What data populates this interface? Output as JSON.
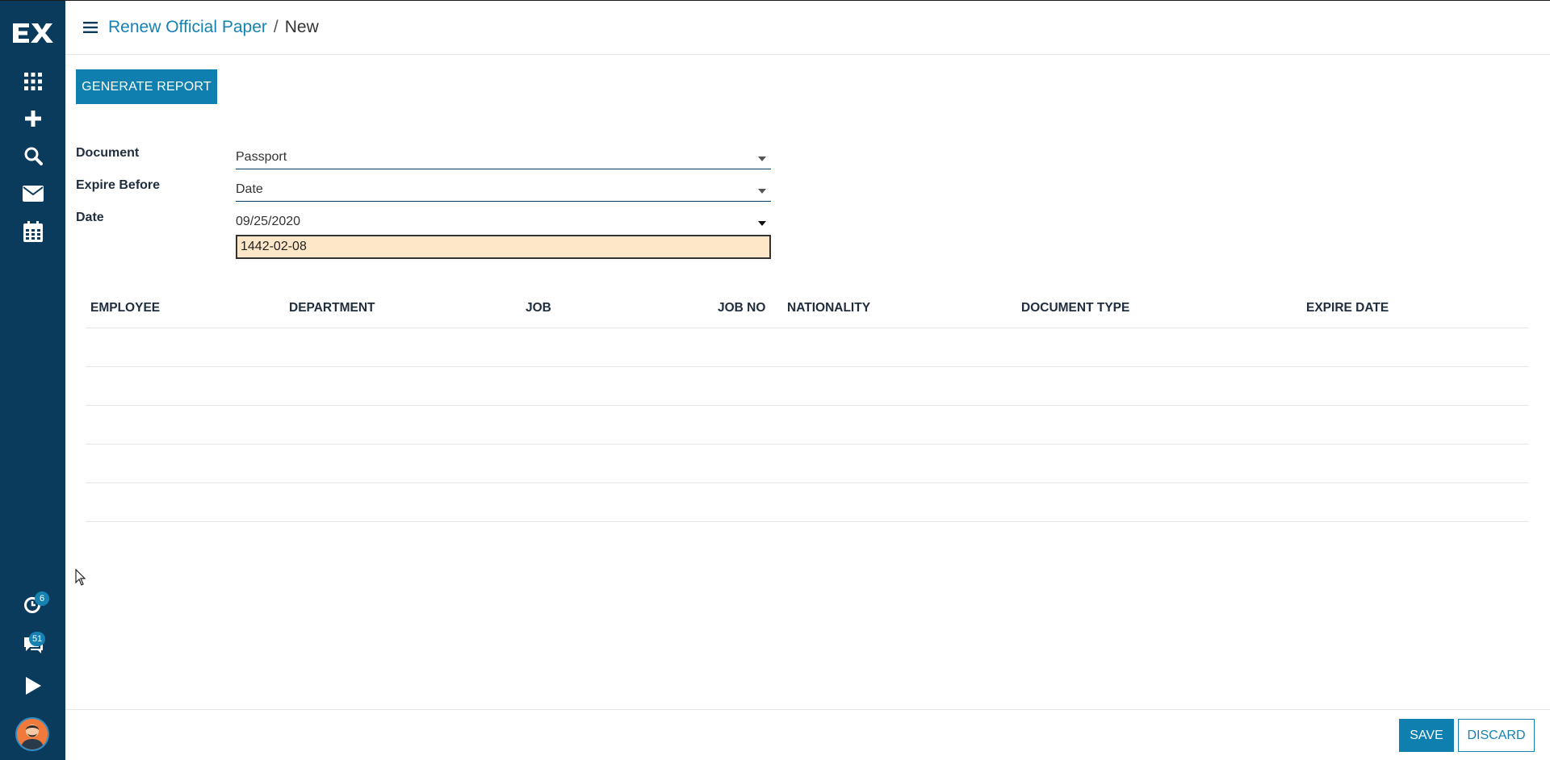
{
  "breadcrumb": {
    "parent": "Renew Official Paper",
    "separator": "/",
    "current": "New"
  },
  "sidebar": {
    "logo": "EX",
    "items": [
      {
        "icon": "apps-grid-icon"
      },
      {
        "icon": "plus-icon"
      },
      {
        "icon": "search-icon"
      },
      {
        "icon": "mail-icon"
      },
      {
        "icon": "calendar-icon"
      }
    ],
    "bottom": {
      "activity_badge": "6",
      "chat_badge": "51"
    }
  },
  "toolbar": {
    "generate_label": "GENERATE REPORT"
  },
  "form": {
    "document_label": "Document",
    "document_value": "Passport",
    "expire_before_label": "Expire Before",
    "expire_before_value": "Date",
    "date_label": "Date",
    "date_value": "09/25/2020",
    "hijri_value": "1442-02-08"
  },
  "table": {
    "columns": [
      "EMPLOYEE",
      "DEPARTMENT",
      "JOB",
      "JOB NO",
      "NATIONALITY",
      "DOCUMENT TYPE",
      "EXPIRE DATE"
    ]
  },
  "footer": {
    "save_label": "SAVE",
    "discard_label": "DISCARD"
  },
  "colors": {
    "sidebar": "#0a3a5c",
    "accent": "#0e7fae",
    "link": "#1681b3",
    "hijri_bg": "#fde7c8"
  }
}
